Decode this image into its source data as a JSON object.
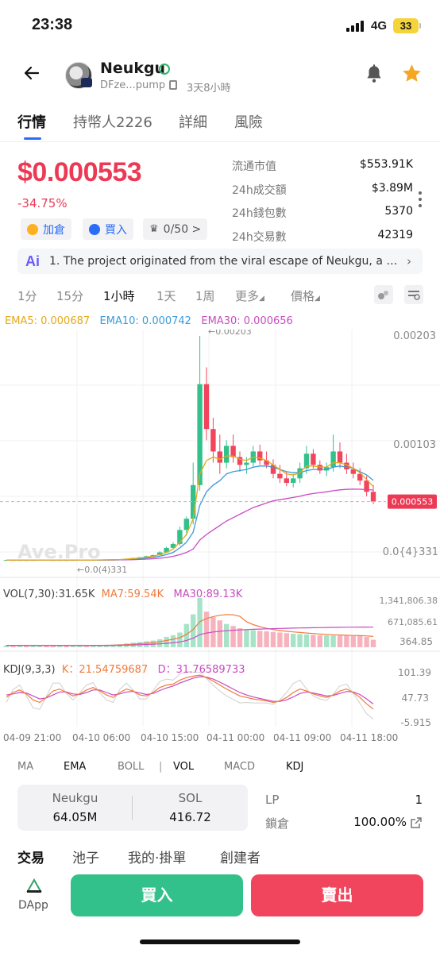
{
  "status": {
    "time": "23:38",
    "network": "4G",
    "battery": "33"
  },
  "header": {
    "token_name": "Neukgu",
    "address": "DFze...pump",
    "age": "3天8小時"
  },
  "tabs": [
    "行情",
    "持幣人2226",
    "詳細",
    "風險"
  ],
  "price": {
    "value": "$0.000553",
    "change": "-34.75%"
  },
  "stats": [
    {
      "label": "流通市值",
      "value": "$553.91K"
    },
    {
      "label": "24h成交額",
      "value": "$3.89M"
    },
    {
      "label": "24h錢包數",
      "value": "5370"
    },
    {
      "label": "24h交易數",
      "value": "42319"
    }
  ],
  "chips": {
    "add": "加倉",
    "buy": "買入",
    "crown": "0/50 >"
  },
  "ai": {
    "logo": "Ai",
    "text": "1. The project originated from the viral escape of Neukgu, a w..."
  },
  "timeframes": [
    "1分",
    "15分",
    "1小時",
    "1天",
    "1周",
    "更多",
    "價格"
  ],
  "legend": {
    "ema5": "EMA5: 0.000687",
    "ema10": "EMA10: 0.000742",
    "ema30": "EMA30: 0.000656"
  },
  "price_axis": {
    "top": "0.00203",
    "mid": "0.00103",
    "low": "0.0{4}331",
    "current": "0.000553",
    "high_marker": "←0.00203",
    "low_marker": "←0.0(4)331"
  },
  "watermark": "Ave.Pro",
  "vol": {
    "label": "VOL(7,30):31.65K",
    "ma7": "MA7:59.54K",
    "ma30": "MA30:89.13K",
    "axis": [
      "1,341,806.38",
      "671,085.61",
      "364.85"
    ]
  },
  "kdj": {
    "label": "KDJ(9,3,3)",
    "k": "K：21.54759687",
    "d": "D：31.76589733",
    "axis": [
      "101.39",
      "47.73",
      "-5.915"
    ]
  },
  "time_axis": [
    "04-09 21:00",
    "04-10 06:00",
    "04-10 15:00",
    "04-11 00:00",
    "04-11 09:00",
    "04-11 18:00"
  ],
  "indicators": [
    "MA",
    "EMA",
    "BOLL",
    "VOL",
    "MACD",
    "KDJ"
  ],
  "pair": {
    "left_name": "Neukgu",
    "left_value": "64.05M",
    "right_name": "SOL",
    "right_value": "416.72"
  },
  "lp": {
    "lp_label": "LP",
    "lp_value": "1",
    "lock_label": "鎖倉",
    "lock_value": "100.00%"
  },
  "bottom_tabs": [
    "交易",
    "池子",
    "我的·掛單",
    "創建者"
  ],
  "actions": {
    "dapp": "DApp",
    "buy": "買入",
    "sell": "賣出"
  },
  "colors": {
    "up": "#33c18b",
    "down": "#f1445d",
    "ema5": "#e6a817",
    "ema10": "#3a9ad9",
    "ema30": "#c94bc0",
    "accent": "#2a6cf6"
  },
  "chart_data": {
    "type": "candlestick",
    "candles": [
      [
        3.1e-05,
        3.3e-05,
        2.9e-05,
        3.2e-05
      ],
      [
        3.2e-05,
        3.4e-05,
        3e-05,
        3.1e-05
      ],
      [
        3.1e-05,
        3.3e-05,
        3e-05,
        3.2e-05
      ],
      [
        3.2e-05,
        3.3e-05,
        3.1e-05,
        3.1e-05
      ],
      [
        3.1e-05,
        3.2e-05,
        3e-05,
        3.2e-05
      ],
      [
        3.2e-05,
        3.4e-05,
        3.1e-05,
        3.3e-05
      ],
      [
        3.3e-05,
        3.4e-05,
        3.1e-05,
        3.2e-05
      ],
      [
        3.2e-05,
        3.3e-05,
        3.1e-05,
        3.1e-05
      ],
      [
        3.1e-05,
        3.3e-05,
        3e-05,
        3.2e-05
      ],
      [
        3.2e-05,
        3.3e-05,
        3.1e-05,
        3.1e-05
      ],
      [
        3.1e-05,
        3.2e-05,
        3e-05,
        3.2e-05
      ],
      [
        3.2e-05,
        3.3e-05,
        3.1e-05,
        3.3e-05
      ],
      [
        3.3e-05,
        3.4e-05,
        3.2e-05,
        3.2e-05
      ],
      [
        3.2e-05,
        3.3e-05,
        3.1e-05,
        3.3e-05
      ],
      [
        3.3e-05,
        3.5e-05,
        3.2e-05,
        3.4e-05
      ],
      [
        3.4e-05,
        3.6e-05,
        3.3e-05,
        3.5e-05
      ],
      [
        3.5e-05,
        3.7e-05,
        3.4e-05,
        3.6e-05
      ],
      [
        3.6e-05,
        4e-05,
        3.5e-05,
        3.9e-05
      ],
      [
        3.9e-05,
        4.5e-05,
        3.8e-05,
        4.3e-05
      ],
      [
        4.3e-05,
        5.2e-05,
        4.1e-05,
        5e-05
      ],
      [
        5e-05,
        6e-05,
        4.8e-05,
        5.6e-05
      ],
      [
        5.6e-05,
        7e-05,
        5.4e-05,
        6.6e-05
      ],
      [
        6.6e-05,
        8e-05,
        6.2e-05,
        7.6e-05
      ],
      [
        7.6e-05,
        0.00011,
        7.2e-05,
        0.0001
      ],
      [
        0.0001,
        0.00015,
        9.5e-05,
        0.00014
      ],
      [
        0.00014,
        0.00019,
        0.00013,
        0.000175
      ],
      [
        0.000175,
        0.00033,
        0.00016,
        0.0003
      ],
      [
        0.0003,
        0.00042,
        0.00025,
        0.0004
      ],
      [
        0.0004,
        0.0009,
        0.00035,
        0.0007
      ],
      [
        0.0007,
        0.00203,
        0.00065,
        0.0016
      ],
      [
        0.0016,
        0.00175,
        0.0011,
        0.0012
      ],
      [
        0.0012,
        0.0013,
        0.0009,
        0.001
      ],
      [
        0.001,
        0.00115,
        0.0008,
        0.0009
      ],
      [
        0.0009,
        0.0011,
        0.00085,
        0.00105
      ],
      [
        0.00105,
        0.00115,
        0.0009,
        0.00095
      ],
      [
        0.00095,
        0.001,
        0.00082,
        0.00088
      ],
      [
        0.00088,
        0.00095,
        0.0008,
        0.0009
      ],
      [
        0.0009,
        0.00105,
        0.00086,
        0.001
      ],
      [
        0.001,
        0.00106,
        0.00088,
        0.00092
      ],
      [
        0.00092,
        0.001,
        0.00085,
        0.00088
      ],
      [
        0.00088,
        0.00093,
        0.00076,
        0.0008
      ],
      [
        0.0008,
        0.00088,
        0.00072,
        0.00076
      ],
      [
        0.00076,
        0.00082,
        0.00069,
        0.00072
      ],
      [
        0.00072,
        0.0008,
        0.00068,
        0.00076
      ],
      [
        0.00076,
        0.0009,
        0.00072,
        0.00085
      ],
      [
        0.00085,
        0.00105,
        0.0008,
        0.00098
      ],
      [
        0.00098,
        0.00102,
        0.00085,
        0.00088
      ],
      [
        0.00088,
        0.00092,
        0.0008,
        0.00083
      ],
      [
        0.00083,
        0.0009,
        0.00078,
        0.00086
      ],
      [
        0.00086,
        0.00115,
        0.00082,
        0.001
      ],
      [
        0.001,
        0.00108,
        0.00085,
        0.0009
      ],
      [
        0.0009,
        0.00098,
        0.0008,
        0.00084
      ],
      [
        0.00084,
        0.0009,
        0.00076,
        0.0008
      ],
      [
        0.0008,
        0.00085,
        0.0007,
        0.00074
      ],
      [
        0.00074,
        0.00078,
        0.0006,
        0.00064
      ],
      [
        0.00064,
        0.0007,
        0.00053,
        0.000553
      ]
    ],
    "price_ticks": [
      0.00203,
      0.00103,
      3.31e-05
    ],
    "ema5": [
      3.2e-05,
      3.2e-05,
      3.2e-05,
      3.2e-05,
      3.2e-05,
      3.2e-05,
      3.2e-05,
      3.2e-05,
      3.2e-05,
      3.2e-05,
      3.2e-05,
      3.2e-05,
      3.2e-05,
      3.2e-05,
      3.3e-05,
      3.4e-05,
      3.5e-05,
      3.6e-05,
      4e-05,
      4.5e-05,
      5e-05,
      5.8e-05,
      6.6e-05,
      8e-05,
      0.0001,
      0.00013,
      0.00019,
      0.00026,
      0.0004,
      0.0008,
      0.00092,
      0.00095,
      0.00093,
      0.00096,
      0.00096,
      0.00093,
      0.00092,
      0.00095,
      0.00094,
      0.00092,
      0.00088,
      0.00084,
      0.0008,
      0.00079,
      0.00081,
      0.00087,
      0.00087,
      0.00086,
      0.00086,
      0.0009,
      0.0009,
      0.00088,
      0.00085,
      0.00081,
      0.00075,
      0.000687
    ],
    "ema10": [
      3.2e-05,
      3.2e-05,
      3.2e-05,
      3.2e-05,
      3.2e-05,
      3.2e-05,
      3.2e-05,
      3.2e-05,
      3.2e-05,
      3.2e-05,
      3.2e-05,
      3.2e-05,
      3.2e-05,
      3.2e-05,
      3.2e-05,
      3.3e-05,
      3.4e-05,
      3.5e-05,
      3.7e-05,
      4e-05,
      4.4e-05,
      5e-05,
      5.6e-05,
      6.6e-05,
      8e-05,
      0.0001,
      0.00014,
      0.00019,
      0.00028,
      0.00052,
      0.00064,
      0.0007,
      0.00074,
      0.0008,
      0.00082,
      0.00083,
      0.00084,
      0.00086,
      0.00087,
      0.00087,
      0.00086,
      0.00084,
      0.00082,
      0.00081,
      0.00081,
      0.00083,
      0.00084,
      0.00084,
      0.00084,
      0.00086,
      0.00087,
      0.00086,
      0.00085,
      0.00082,
      0.00079,
      0.000742
    ],
    "ema30": [
      3.2e-05,
      3.2e-05,
      3.2e-05,
      3.2e-05,
      3.2e-05,
      3.2e-05,
      3.2e-05,
      3.2e-05,
      3.2e-05,
      3.2e-05,
      3.2e-05,
      3.2e-05,
      3.2e-05,
      3.2e-05,
      3.2e-05,
      3.2e-05,
      3.2e-05,
      3.3e-05,
      3.4e-05,
      3.5e-05,
      3.7e-05,
      4e-05,
      4.3e-05,
      4.8e-05,
      5.5e-05,
      6.5e-05,
      8e-05,
      0.0001,
      0.00013,
      0.00021,
      0.00026,
      0.0003,
      0.00034,
      0.00038,
      0.00041,
      0.00044,
      0.00047,
      0.0005,
      0.00052,
      0.00054,
      0.00056,
      0.00057,
      0.00058,
      0.00059,
      0.0006,
      0.000615,
      0.000625,
      0.000632,
      0.00064,
      0.00065,
      0.000658,
      0.000662,
      0.000664,
      0.000663,
      0.00066,
      0.000656
    ],
    "volume": [
      2000,
      1800,
      2100,
      1500,
      1700,
      2200,
      1900,
      1600,
      1800,
      2000,
      1700,
      2100,
      2300,
      2000,
      2500,
      3000,
      3500,
      5000,
      8000,
      12000,
      15000,
      20000,
      25000,
      35000,
      60000,
      80000,
      120000,
      300000,
      600000,
      1341806,
      700000,
      500000,
      400000,
      300000,
      250000,
      200000,
      180000,
      160000,
      150000,
      140000,
      130000,
      120000,
      110000,
      100000,
      95000,
      90000,
      85000,
      80000,
      78000,
      76000,
      74000,
      72000,
      70000,
      68000,
      60000,
      31650
    ],
    "vol_ticks": [
      1341806.38,
      671085.61,
      364.85
    ],
    "kdj_k": [
      45,
      55,
      60,
      52,
      40,
      35,
      45,
      58,
      62,
      55,
      48,
      52,
      60,
      65,
      58,
      50,
      45,
      55,
      62,
      58,
      50,
      48,
      55,
      65,
      70,
      72,
      80,
      85,
      88,
      90,
      85,
      78,
      70,
      62,
      55,
      48,
      45,
      42,
      40,
      38,
      35,
      38,
      45,
      55,
      62,
      58,
      52,
      48,
      45,
      50,
      58,
      62,
      55,
      45,
      32,
      21.55
    ],
    "kdj_d": [
      50,
      52,
      55,
      54,
      48,
      42,
      44,
      50,
      56,
      56,
      52,
      51,
      55,
      60,
      60,
      55,
      50,
      52,
      56,
      57,
      54,
      51,
      53,
      59,
      64,
      68,
      74,
      79,
      84,
      87,
      86,
      82,
      76,
      69,
      62,
      55,
      50,
      46,
      43,
      40,
      37,
      37,
      40,
      46,
      53,
      56,
      54,
      51,
      48,
      49,
      53,
      57,
      56,
      51,
      42,
      31.77
    ],
    "kdj_ticks": [
      101.39,
      47.73,
      -5.915
    ]
  }
}
